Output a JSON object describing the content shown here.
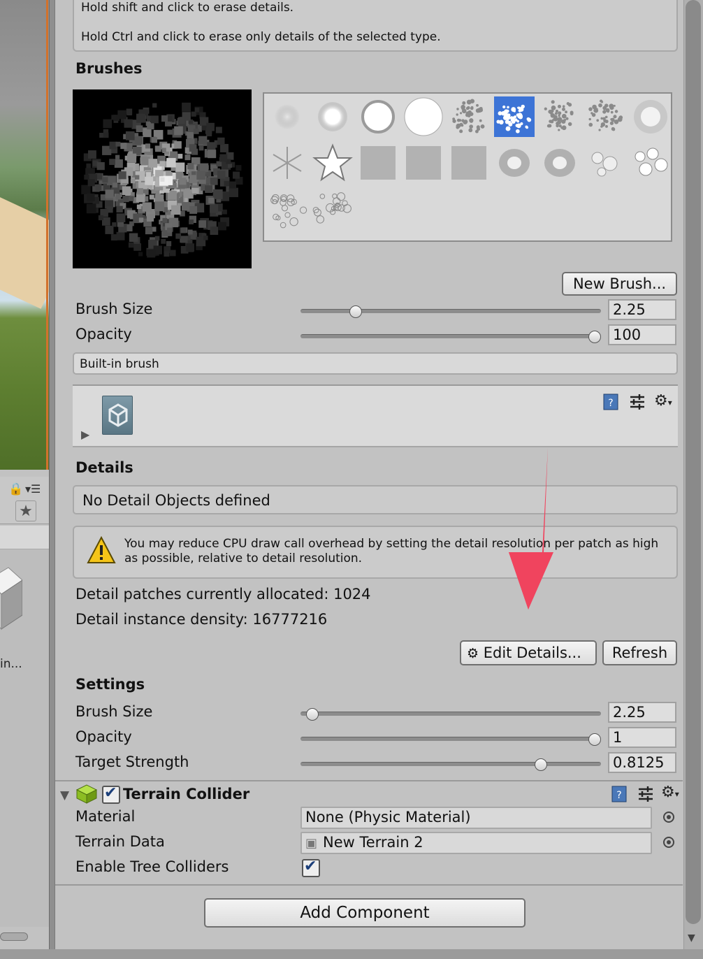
{
  "inspector": {
    "help_lines": [
      "Hold shift and click to erase details.",
      "Hold Ctrl and click to erase only details of the selected type."
    ],
    "brushes": {
      "title": "Brushes",
      "new_brush_label": "New Brush...",
      "selected_index": 5,
      "brush_size": {
        "label": "Brush Size",
        "value": "2.25",
        "fraction": 0.17
      },
      "opacity": {
        "label": "Opacity",
        "value": "100",
        "fraction": 1.0
      },
      "brush_name": "Built-in brush"
    },
    "details": {
      "title": "Details",
      "empty_message": "No Detail Objects defined",
      "warning": "You may reduce CPU draw call overhead by setting the detail resolution per patch as high as possible, relative to detail resolution.",
      "patches_text": "Detail patches currently allocated: 1024",
      "density_text": "Detail instance density: 16777216",
      "edit_label": "Edit Details...",
      "refresh_label": "Refresh"
    },
    "settings": {
      "title": "Settings",
      "brush_size": {
        "label": "Brush Size",
        "value": "2.25",
        "fraction": 0.02
      },
      "opacity": {
        "label": "Opacity",
        "value": "1",
        "fraction": 1.0
      },
      "target_strength": {
        "label": "Target Strength",
        "value": "0.8125",
        "fraction": 0.8125
      }
    },
    "terrain_collider": {
      "title": "Terrain Collider",
      "enabled": true,
      "material": {
        "label": "Material",
        "value": "None (Physic Material)"
      },
      "terrain_data": {
        "label": "Terrain Data",
        "value": "New Terrain 2"
      },
      "tree_colliders": {
        "label": "Enable Tree Colliders",
        "checked": true
      }
    },
    "add_component_label": "Add Component"
  },
  "project": {
    "asset_label": "in..."
  },
  "colors": {
    "selection": "#3d74d6",
    "annotation_arrow": "#f0445e",
    "warning_yellow": "#f5c518"
  }
}
